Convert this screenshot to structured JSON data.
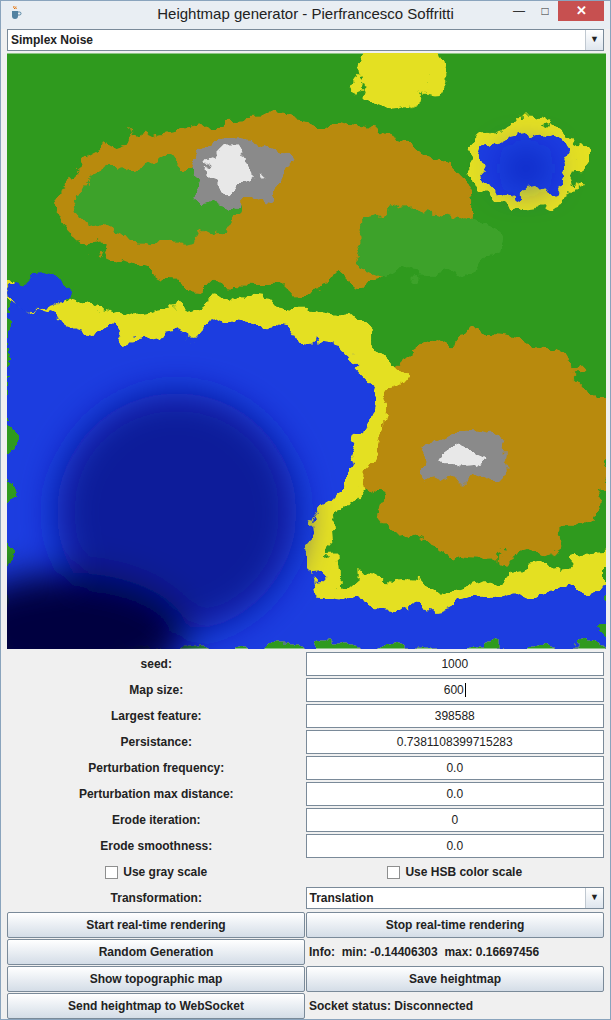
{
  "window": {
    "title": "Heightmap generator - Pierfrancesco Soffritti",
    "controls": [
      "—",
      "□",
      "✕"
    ]
  },
  "generator": {
    "value": "Simplex Noise",
    "arrow": "▼"
  },
  "fields": [
    {
      "label": "seed:",
      "value": "1000",
      "focused": false
    },
    {
      "label": "Map size:",
      "value": "600",
      "focused": true
    },
    {
      "label": "Largest feature:",
      "value": "398588",
      "focused": false
    },
    {
      "label": "Persistance:",
      "value": "0.7381108399715283",
      "focused": false
    },
    {
      "label": "Perturbation frequency:",
      "value": "0.0",
      "focused": false
    },
    {
      "label": "Perturbation max distance:",
      "value": "0.0",
      "focused": false
    },
    {
      "label": "Erode iteration:",
      "value": "0",
      "focused": false
    },
    {
      "label": "Erode smoothness:",
      "value": "0.0",
      "focused": false
    }
  ],
  "checkboxes": [
    {
      "label": "Use gray scale",
      "checked": false
    },
    {
      "label": "Use HSB color scale",
      "checked": false
    }
  ],
  "transformation": {
    "label": "Transformation:",
    "value": "Translation",
    "arrow": "▼"
  },
  "actions": [
    [
      {
        "kind": "button",
        "text": "Start real-time rendering"
      },
      {
        "kind": "button",
        "text": "Stop real-time rendering"
      }
    ],
    [
      {
        "kind": "button",
        "text": "Random Generation"
      },
      {
        "kind": "label",
        "text": "Info:  min: -0.14406303  max: 0.16697456"
      }
    ],
    [
      {
        "kind": "button",
        "text": "Show topographic map"
      },
      {
        "kind": "button",
        "text": "Save heightmap"
      }
    ],
    [
      {
        "kind": "button",
        "text": "Send heightmap to WebSocket"
      },
      {
        "kind": "label",
        "text": "Socket status: Disconnected"
      }
    ]
  ]
}
